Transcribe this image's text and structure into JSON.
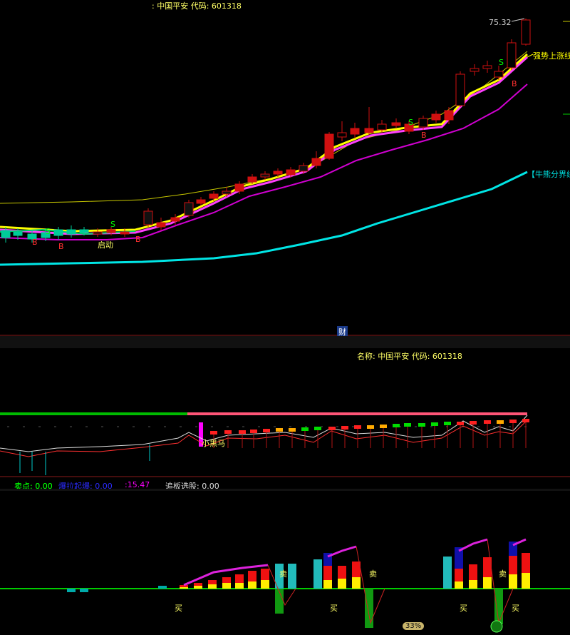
{
  "main_pane": {
    "header": ": 中国平安 代码: 601318",
    "price_label": "75.32",
    "strong_label": "强势上涨线",
    "bull_bear_label": "【牛熊分界线",
    "start_label": "启动",
    "finance_label": "财",
    "signal_s": "S",
    "signal_b": "B"
  },
  "mid_pane": {
    "header": "名称: 中国平安 代码: 601318",
    "dark_horse": "小黑马",
    "status": {
      "sell_label": "卖点: 0.00",
      "surge_label": "爆拉起爆: 0.00",
      "value3_label": ":15.47",
      "chase_label": "追板选股: 0.00"
    }
  },
  "bot_pane": {
    "buy": "买",
    "sell": "卖",
    "badge": "33%"
  },
  "colors": {
    "up": "#ff2020",
    "down": "#000000",
    "ma_yellow": "#ffff00",
    "ma_magenta": "#ff00ff",
    "bull_bear": "#00e5e5",
    "header_text": "#ffff66",
    "green_line": "#00cc00"
  }
}
